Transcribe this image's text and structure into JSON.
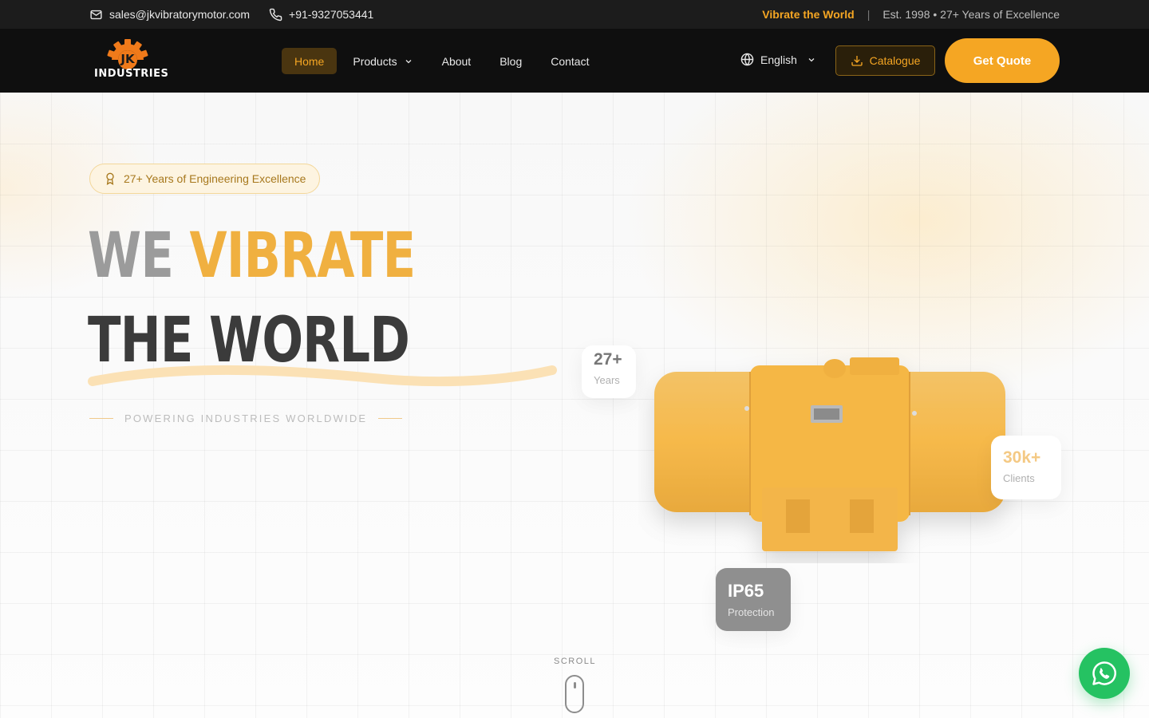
{
  "topbar": {
    "email": "sales@jkvibratorymotor.com",
    "phone": "+91-9327053441",
    "tagline": "Vibrate the World",
    "separator": "|",
    "established": "Est. 1998 • 27+ Years of Excellence"
  },
  "nav": {
    "logo": {
      "text": "INDUSTRIES",
      "monogram": "JK"
    },
    "items": [
      {
        "label": "Home",
        "active": true
      },
      {
        "label": "Products",
        "has_dropdown": true
      },
      {
        "label": "About"
      },
      {
        "label": "Blog"
      },
      {
        "label": "Contact"
      }
    ],
    "language": "English",
    "catalogue_label": "Catalogue",
    "quote_label": "Get Quote"
  },
  "hero": {
    "badge": "27+ Years of Engineering Excellence",
    "headline_word1": "WE",
    "headline_word2": "VIBRATE",
    "headline_line2": "THE WORLD",
    "subtitle": "POWERING INDUSTRIES WORLDWIDE",
    "stats": {
      "years": {
        "value": "27+",
        "label": "Years"
      },
      "clients": {
        "value": "30k+",
        "label": "Clients"
      },
      "protection": {
        "value": "IP65",
        "label": "Protection"
      }
    },
    "scroll_label": "SCROLL"
  },
  "colors": {
    "accent": "#f5a623",
    "dark": "#0f0f0f",
    "whatsapp": "#25c262"
  },
  "icons": [
    "mail-icon",
    "phone-icon",
    "globe-icon",
    "download-icon",
    "award-icon",
    "whatsapp-icon",
    "chevron-down-icon"
  ]
}
